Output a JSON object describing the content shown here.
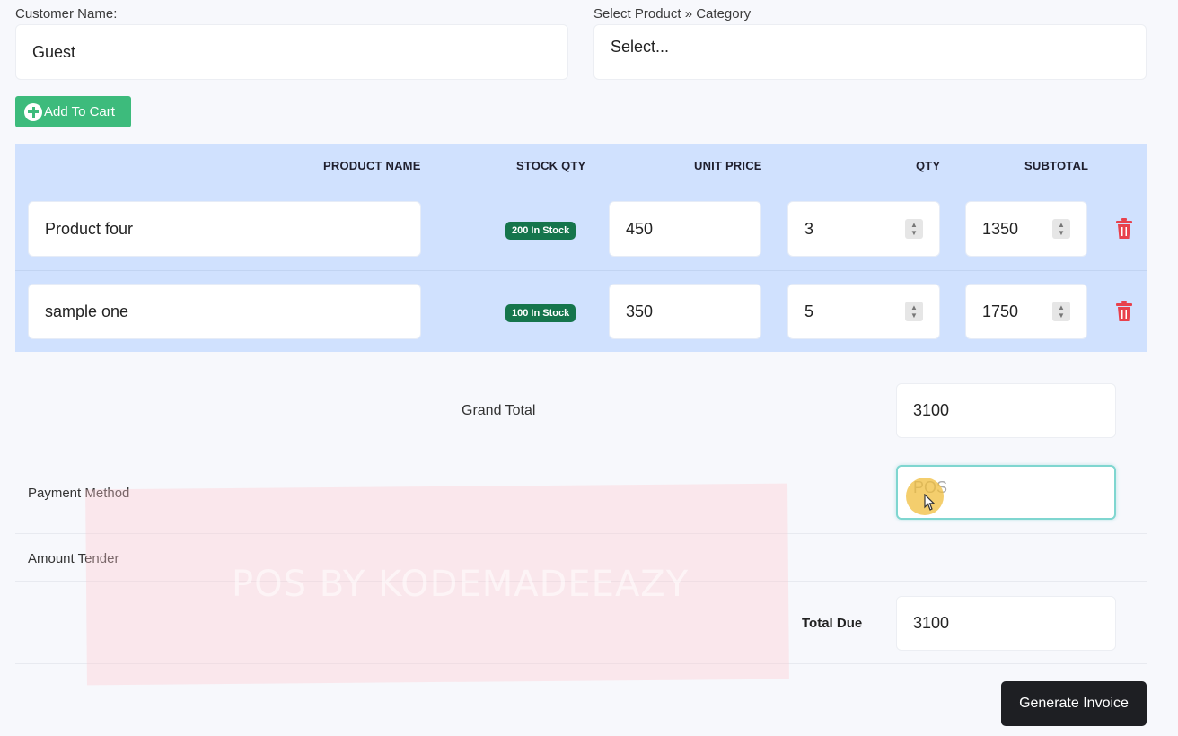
{
  "customer": {
    "label": "Customer Name:",
    "value": "Guest"
  },
  "product_select": {
    "label": "Select Product » Category",
    "value": "Select..."
  },
  "add_to_cart": {
    "label": "Add To Cart",
    "icon": "plus-circle-icon"
  },
  "table": {
    "headers": {
      "product_name": "PRODUCT NAME",
      "stock_qty": "STOCK QTY",
      "unit_price": "UNIT PRICE",
      "qty": "QTY",
      "subtotal": "SUBTOTAL"
    },
    "rows": [
      {
        "product_name": "Product four",
        "stock": "200 In Stock",
        "unit_price": "450",
        "qty": "3",
        "subtotal": "1350"
      },
      {
        "product_name": "sample one",
        "stock": "100 In Stock",
        "unit_price": "350",
        "qty": "5",
        "subtotal": "1750"
      }
    ],
    "delete_icon": "trash-icon"
  },
  "summary": {
    "grand_total_label": "Grand Total",
    "grand_total_value": "3100",
    "payment_method_label": "Payment Method",
    "payment_method_value": "POS",
    "amount_tender_label": "Amount Tender",
    "total_due_label": "Total Due",
    "total_due_value": "3100"
  },
  "watermark": "POS BY KODEMADEEAZY",
  "generate_invoice": {
    "label": "Generate Invoice"
  },
  "colors": {
    "accent_green": "#3dbb7c",
    "badge_green": "#15754c",
    "table_bg": "#d0e1fe",
    "delete_red": "#e8414d",
    "dark_button": "#1e1f23"
  }
}
